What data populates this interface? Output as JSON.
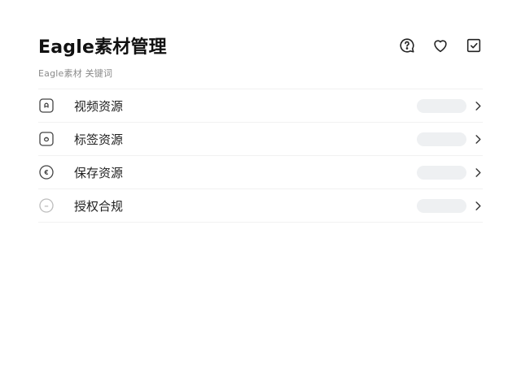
{
  "header": {
    "title": "Eagle素材管理",
    "actions": [
      {
        "name": "comment-icon"
      },
      {
        "name": "heart-icon"
      },
      {
        "name": "checkbox-icon"
      }
    ]
  },
  "subtitle": "Eagle素材 关键词",
  "list": {
    "items": [
      {
        "label": "视频资源",
        "icon": "camera-square-icon"
      },
      {
        "label": "标签资源",
        "icon": "tag-square-icon"
      },
      {
        "label": "保存资源",
        "icon": "save-round-icon"
      },
      {
        "label": "授权合规",
        "icon": "license-round-icon"
      }
    ]
  },
  "colors": {
    "accent": "#111111",
    "pill": "#eef0f2",
    "divider": "#f1f1f1",
    "muted": "#8a8a8a"
  }
}
